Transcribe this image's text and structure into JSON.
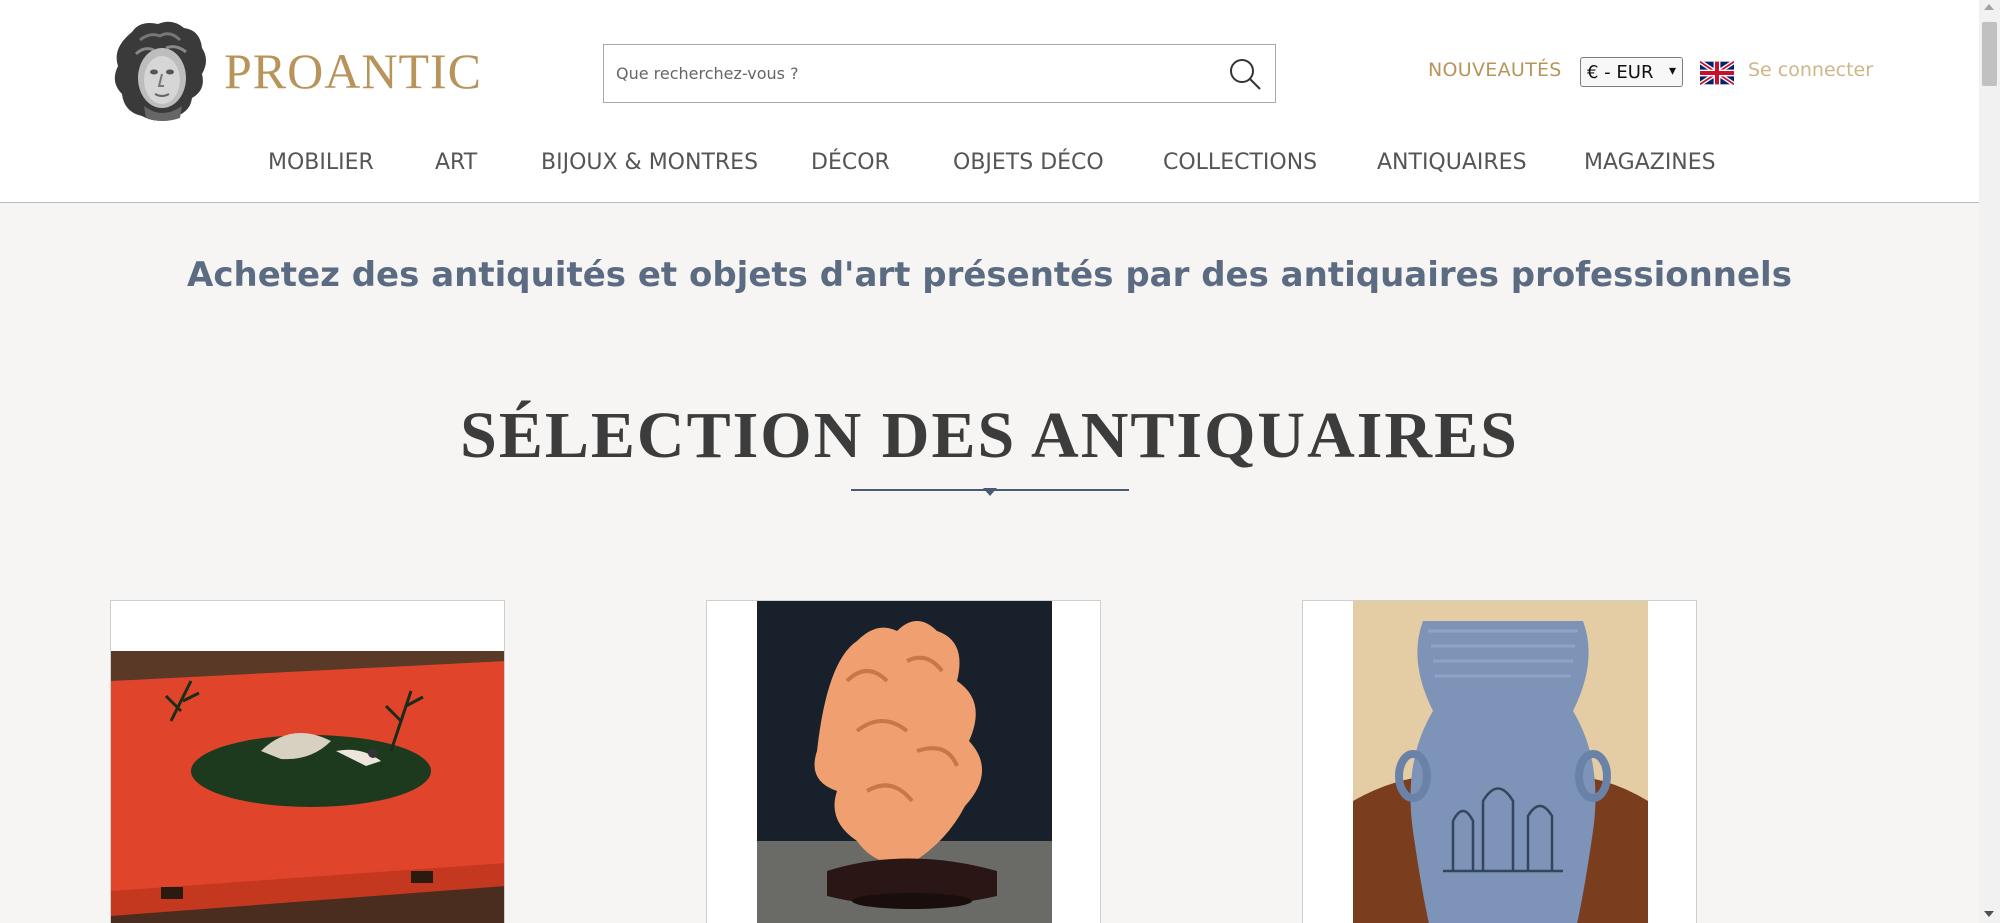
{
  "header": {
    "logo_text": "PROANTIC",
    "search": {
      "placeholder": "Que recherchez-vous ?"
    },
    "nouveautes_label": "NOUVEAUTÉS",
    "currency": {
      "selected": "€ - EUR"
    },
    "language_flag": "uk-flag-icon",
    "login_label": "Se connecter"
  },
  "nav": {
    "items": [
      {
        "label": "MOBILIER"
      },
      {
        "label": "ART"
      },
      {
        "label": "BIJOUX & MONTRES"
      },
      {
        "label": "DÉCOR"
      },
      {
        "label": "OBJETS DÉCO"
      },
      {
        "label": "COLLECTIONS"
      },
      {
        "label": "ANTIQUAIRES"
      },
      {
        "label": "MAGAZINES"
      }
    ]
  },
  "main": {
    "tagline": "Achetez des antiquités et objets d'art présentés par des antiquaires professionnels",
    "section_title": "SÉLECTION DES ANTIQUAIRES",
    "products": [
      {
        "image": "red-lacquer-box"
      },
      {
        "image": "carved-coral-sculpture"
      },
      {
        "image": "blue-ceramic-vase"
      }
    ]
  },
  "colors": {
    "brand_gold": "#b8945a",
    "tagline_blue": "#5a6b82",
    "background": "#f6f5f3"
  }
}
